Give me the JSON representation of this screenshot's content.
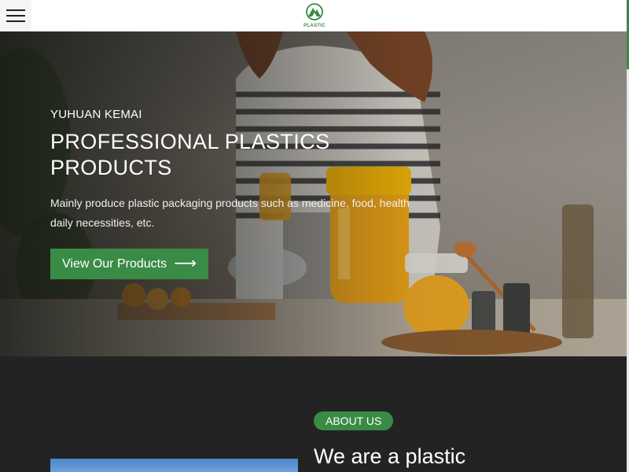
{
  "header": {
    "menu_icon": "hamburger-icon",
    "logo_icon": "mountain-logo-icon",
    "logo_text": "PLASTIC"
  },
  "hero": {
    "eyebrow": "YUHUAN KEMAI",
    "title": "PROFESSIONAL PLASTICS PRODUCTS",
    "description": "Mainly produce plastic packaging products such as medicine, food, health daily necessities, etc.",
    "cta_label": "View Our Products",
    "cta_icon": "arrow-right-icon"
  },
  "about": {
    "badge": "ABOUT US",
    "heading": "We are a plastic"
  },
  "colors": {
    "accent": "#3a8b45",
    "dark_section": "#232323"
  }
}
